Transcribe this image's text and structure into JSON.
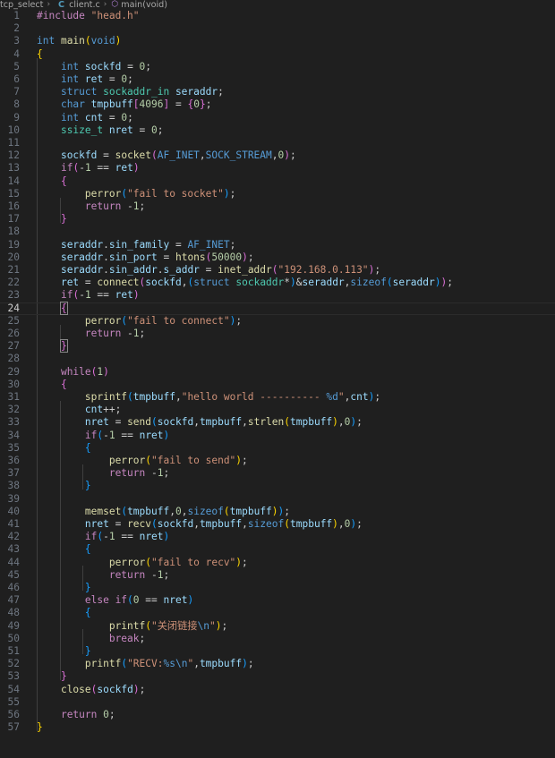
{
  "breadcrumb": {
    "folder": "tcp_select",
    "file_icon": "C",
    "file": "client.c",
    "symbol": "main(void)"
  },
  "editor": {
    "current_line": 24,
    "lines": [
      [
        [
          "t-ctl",
          "#include "
        ],
        [
          "t-str",
          "\"head.h\""
        ]
      ],
      [],
      [
        [
          "t-kw",
          "int "
        ],
        [
          "t-fn",
          "main"
        ],
        [
          "b1",
          "("
        ],
        [
          "t-kw",
          "void"
        ],
        [
          "b1",
          ")"
        ]
      ],
      [
        [
          "b1",
          "{"
        ]
      ],
      [
        [
          "t-p",
          "    "
        ],
        [
          "t-kw",
          "int "
        ],
        [
          "t-var",
          "sockfd"
        ],
        [
          "t-p",
          " = "
        ],
        [
          "t-num",
          "0"
        ],
        [
          "t-p",
          ";"
        ]
      ],
      [
        [
          "t-p",
          "    "
        ],
        [
          "t-kw",
          "int "
        ],
        [
          "t-var",
          "ret"
        ],
        [
          "t-p",
          " = "
        ],
        [
          "t-num",
          "0"
        ],
        [
          "t-p",
          ";"
        ]
      ],
      [
        [
          "t-p",
          "    "
        ],
        [
          "t-kw",
          "struct "
        ],
        [
          "t-ty",
          "sockaddr_in "
        ],
        [
          "t-var",
          "seraddr"
        ],
        [
          "t-p",
          ";"
        ]
      ],
      [
        [
          "t-p",
          "    "
        ],
        [
          "t-kw",
          "char "
        ],
        [
          "t-var",
          "tmpbuff"
        ],
        [
          "b2",
          "["
        ],
        [
          "t-num",
          "4096"
        ],
        [
          "b2",
          "]"
        ],
        [
          "t-p",
          " = "
        ],
        [
          "b2",
          "{"
        ],
        [
          "t-num",
          "0"
        ],
        [
          "b2",
          "}"
        ],
        [
          "t-p",
          ";"
        ]
      ],
      [
        [
          "t-p",
          "    "
        ],
        [
          "t-kw",
          "int "
        ],
        [
          "t-var",
          "cnt"
        ],
        [
          "t-p",
          " = "
        ],
        [
          "t-num",
          "0"
        ],
        [
          "t-p",
          ";"
        ]
      ],
      [
        [
          "t-p",
          "    "
        ],
        [
          "t-ty",
          "ssize_t "
        ],
        [
          "t-var",
          "nret"
        ],
        [
          "t-p",
          " = "
        ],
        [
          "t-num",
          "0"
        ],
        [
          "t-p",
          ";"
        ]
      ],
      [],
      [
        [
          "t-p",
          "    "
        ],
        [
          "t-var",
          "sockfd"
        ],
        [
          "t-p",
          " = "
        ],
        [
          "t-fn",
          "socket"
        ],
        [
          "b2",
          "("
        ],
        [
          "t-mac",
          "AF_INET"
        ],
        [
          "t-p",
          ","
        ],
        [
          "t-mac",
          "SOCK_STREAM"
        ],
        [
          "t-p",
          ","
        ],
        [
          "t-num",
          "0"
        ],
        [
          "b2",
          ")"
        ],
        [
          "t-p",
          ";"
        ]
      ],
      [
        [
          "t-p",
          "    "
        ],
        [
          "t-ctl",
          "if"
        ],
        [
          "b2",
          "("
        ],
        [
          "t-p",
          "-"
        ],
        [
          "t-num",
          "1"
        ],
        [
          "t-p",
          " == "
        ],
        [
          "t-var",
          "ret"
        ],
        [
          "b2",
          ")"
        ]
      ],
      [
        [
          "t-p",
          "    "
        ],
        [
          "b2",
          "{"
        ]
      ],
      [
        [
          "t-p",
          "        "
        ],
        [
          "t-fn",
          "perror"
        ],
        [
          "b3",
          "("
        ],
        [
          "t-str",
          "\"fail to socket\""
        ],
        [
          "b3",
          ")"
        ],
        [
          "t-p",
          ";"
        ]
      ],
      [
        [
          "t-p",
          "        "
        ],
        [
          "t-ctl",
          "return "
        ],
        [
          "t-p",
          "-"
        ],
        [
          "t-num",
          "1"
        ],
        [
          "t-p",
          ";"
        ]
      ],
      [
        [
          "t-p",
          "    "
        ],
        [
          "b2",
          "}"
        ]
      ],
      [],
      [
        [
          "t-p",
          "    "
        ],
        [
          "t-var",
          "seraddr"
        ],
        [
          "t-p",
          "."
        ],
        [
          "t-var",
          "sin_family"
        ],
        [
          "t-p",
          " = "
        ],
        [
          "t-mac",
          "AF_INET"
        ],
        [
          "t-p",
          ";"
        ]
      ],
      [
        [
          "t-p",
          "    "
        ],
        [
          "t-var",
          "seraddr"
        ],
        [
          "t-p",
          "."
        ],
        [
          "t-var",
          "sin_port"
        ],
        [
          "t-p",
          " = "
        ],
        [
          "t-fn",
          "htons"
        ],
        [
          "b2",
          "("
        ],
        [
          "t-num",
          "50000"
        ],
        [
          "b2",
          ")"
        ],
        [
          "t-p",
          ";"
        ]
      ],
      [
        [
          "t-p",
          "    "
        ],
        [
          "t-var",
          "seraddr"
        ],
        [
          "t-p",
          "."
        ],
        [
          "t-var",
          "sin_addr"
        ],
        [
          "t-p",
          "."
        ],
        [
          "t-var",
          "s_addr"
        ],
        [
          "t-p",
          " = "
        ],
        [
          "t-fn",
          "inet_addr"
        ],
        [
          "b2",
          "("
        ],
        [
          "t-str",
          "\"192.168.0.113\""
        ],
        [
          "b2",
          ")"
        ],
        [
          "t-p",
          ";"
        ]
      ],
      [
        [
          "t-p",
          "    "
        ],
        [
          "t-var",
          "ret"
        ],
        [
          "t-p",
          " = "
        ],
        [
          "t-fn",
          "connect"
        ],
        [
          "b2",
          "("
        ],
        [
          "t-var",
          "sockfd"
        ],
        [
          "t-p",
          ","
        ],
        [
          "b3",
          "("
        ],
        [
          "t-kw",
          "struct "
        ],
        [
          "t-ty",
          "sockaddr"
        ],
        [
          "t-p",
          "*"
        ],
        [
          "b3",
          ")"
        ],
        [
          "t-p",
          "&"
        ],
        [
          "t-var",
          "seraddr"
        ],
        [
          "t-p",
          ","
        ],
        [
          "t-kw",
          "sizeof"
        ],
        [
          "b3",
          "("
        ],
        [
          "t-var",
          "seraddr"
        ],
        [
          "b3",
          ")"
        ],
        [
          "b2",
          ")"
        ],
        [
          "t-p",
          ";"
        ]
      ],
      [
        [
          "t-p",
          "    "
        ],
        [
          "t-ctl",
          "if"
        ],
        [
          "b2",
          "("
        ],
        [
          "t-p",
          "-"
        ],
        [
          "t-num",
          "1"
        ],
        [
          "t-p",
          " == "
        ],
        [
          "t-var",
          "ret"
        ],
        [
          "b2",
          ")"
        ]
      ],
      [
        [
          "t-p",
          "    "
        ],
        [
          "b2",
          "{"
        ]
      ],
      [
        [
          "t-p",
          "        "
        ],
        [
          "t-fn",
          "perror"
        ],
        [
          "b3",
          "("
        ],
        [
          "t-str",
          "\"fail to connect\""
        ],
        [
          "b3",
          ")"
        ],
        [
          "t-p",
          ";"
        ]
      ],
      [
        [
          "t-p",
          "        "
        ],
        [
          "t-ctl",
          "return "
        ],
        [
          "t-p",
          "-"
        ],
        [
          "t-num",
          "1"
        ],
        [
          "t-p",
          ";"
        ]
      ],
      [
        [
          "t-p",
          "    "
        ],
        [
          "b2",
          "}"
        ]
      ],
      [],
      [
        [
          "t-p",
          "    "
        ],
        [
          "t-ctl",
          "while"
        ],
        [
          "b2",
          "("
        ],
        [
          "t-num",
          "1"
        ],
        [
          "b2",
          ")"
        ]
      ],
      [
        [
          "t-p",
          "    "
        ],
        [
          "b2",
          "{"
        ]
      ],
      [
        [
          "t-p",
          "        "
        ],
        [
          "t-fn",
          "sprintf"
        ],
        [
          "b3",
          "("
        ],
        [
          "t-var",
          "tmpbuff"
        ],
        [
          "t-p",
          ","
        ],
        [
          "t-str",
          "\"hello world ---------- "
        ],
        [
          "t-kw",
          "%d"
        ],
        [
          "t-str",
          "\""
        ],
        [
          "t-p",
          ","
        ],
        [
          "t-var",
          "cnt"
        ],
        [
          "b3",
          ")"
        ],
        [
          "t-p",
          ";"
        ]
      ],
      [
        [
          "t-p",
          "        "
        ],
        [
          "t-var",
          "cnt"
        ],
        [
          "t-p",
          "++;"
        ]
      ],
      [
        [
          "t-p",
          "        "
        ],
        [
          "t-var",
          "nret"
        ],
        [
          "t-p",
          " = "
        ],
        [
          "t-fn",
          "send"
        ],
        [
          "b3",
          "("
        ],
        [
          "t-var",
          "sockfd"
        ],
        [
          "t-p",
          ","
        ],
        [
          "t-var",
          "tmpbuff"
        ],
        [
          "t-p",
          ","
        ],
        [
          "t-fn",
          "strlen"
        ],
        [
          "b1",
          "("
        ],
        [
          "t-var",
          "tmpbuff"
        ],
        [
          "b1",
          ")"
        ],
        [
          "t-p",
          ","
        ],
        [
          "t-num",
          "0"
        ],
        [
          "b3",
          ")"
        ],
        [
          "t-p",
          ";"
        ]
      ],
      [
        [
          "t-p",
          "        "
        ],
        [
          "t-ctl",
          "if"
        ],
        [
          "b3",
          "("
        ],
        [
          "t-p",
          "-"
        ],
        [
          "t-num",
          "1"
        ],
        [
          "t-p",
          " == "
        ],
        [
          "t-var",
          "nret"
        ],
        [
          "b3",
          ")"
        ]
      ],
      [
        [
          "t-p",
          "        "
        ],
        [
          "b3",
          "{"
        ]
      ],
      [
        [
          "t-p",
          "            "
        ],
        [
          "t-fn",
          "perror"
        ],
        [
          "b1",
          "("
        ],
        [
          "t-str",
          "\"fail to send\""
        ],
        [
          "b1",
          ")"
        ],
        [
          "t-p",
          ";"
        ]
      ],
      [
        [
          "t-p",
          "            "
        ],
        [
          "t-ctl",
          "return "
        ],
        [
          "t-p",
          "-"
        ],
        [
          "t-num",
          "1"
        ],
        [
          "t-p",
          ";"
        ]
      ],
      [
        [
          "t-p",
          "        "
        ],
        [
          "b3",
          "}"
        ]
      ],
      [],
      [
        [
          "t-p",
          "        "
        ],
        [
          "t-fn",
          "memset"
        ],
        [
          "b3",
          "("
        ],
        [
          "t-var",
          "tmpbuff"
        ],
        [
          "t-p",
          ","
        ],
        [
          "t-num",
          "0"
        ],
        [
          "t-p",
          ","
        ],
        [
          "t-kw",
          "sizeof"
        ],
        [
          "b1",
          "("
        ],
        [
          "t-var",
          "tmpbuff"
        ],
        [
          "b1",
          ")"
        ],
        [
          "b3",
          ")"
        ],
        [
          "t-p",
          ";"
        ]
      ],
      [
        [
          "t-p",
          "        "
        ],
        [
          "t-var",
          "nret"
        ],
        [
          "t-p",
          " = "
        ],
        [
          "t-fn",
          "recv"
        ],
        [
          "b3",
          "("
        ],
        [
          "t-var",
          "sockfd"
        ],
        [
          "t-p",
          ","
        ],
        [
          "t-var",
          "tmpbuff"
        ],
        [
          "t-p",
          ","
        ],
        [
          "t-kw",
          "sizeof"
        ],
        [
          "b1",
          "("
        ],
        [
          "t-var",
          "tmpbuff"
        ],
        [
          "b1",
          ")"
        ],
        [
          "t-p",
          ","
        ],
        [
          "t-num",
          "0"
        ],
        [
          "b3",
          ")"
        ],
        [
          "t-p",
          ";"
        ]
      ],
      [
        [
          "t-p",
          "        "
        ],
        [
          "t-ctl",
          "if"
        ],
        [
          "b3",
          "("
        ],
        [
          "t-p",
          "-"
        ],
        [
          "t-num",
          "1"
        ],
        [
          "t-p",
          " == "
        ],
        [
          "t-var",
          "nret"
        ],
        [
          "b3",
          ")"
        ]
      ],
      [
        [
          "t-p",
          "        "
        ],
        [
          "b3",
          "{"
        ]
      ],
      [
        [
          "t-p",
          "            "
        ],
        [
          "t-fn",
          "perror"
        ],
        [
          "b1",
          "("
        ],
        [
          "t-str",
          "\"fail to recv\""
        ],
        [
          "b1",
          ")"
        ],
        [
          "t-p",
          ";"
        ]
      ],
      [
        [
          "t-p",
          "            "
        ],
        [
          "t-ctl",
          "return "
        ],
        [
          "t-p",
          "-"
        ],
        [
          "t-num",
          "1"
        ],
        [
          "t-p",
          ";"
        ]
      ],
      [
        [
          "t-p",
          "        "
        ],
        [
          "b3",
          "}"
        ]
      ],
      [
        [
          "t-p",
          "        "
        ],
        [
          "t-ctl",
          "else if"
        ],
        [
          "b3",
          "("
        ],
        [
          "t-num",
          "0"
        ],
        [
          "t-p",
          " == "
        ],
        [
          "t-var",
          "nret"
        ],
        [
          "b3",
          ")"
        ]
      ],
      [
        [
          "t-p",
          "        "
        ],
        [
          "b3",
          "{"
        ]
      ],
      [
        [
          "t-p",
          "            "
        ],
        [
          "t-fn",
          "printf"
        ],
        [
          "b1",
          "("
        ],
        [
          "t-str",
          "\"关闭链接"
        ],
        [
          "t-kw",
          "\\n"
        ],
        [
          "t-str",
          "\""
        ],
        [
          "b1",
          ")"
        ],
        [
          "t-p",
          ";"
        ]
      ],
      [
        [
          "t-p",
          "            "
        ],
        [
          "t-ctl",
          "break"
        ],
        [
          "t-p",
          ";"
        ]
      ],
      [
        [
          "t-p",
          "        "
        ],
        [
          "b3",
          "}"
        ]
      ],
      [
        [
          "t-p",
          "        "
        ],
        [
          "t-fn",
          "printf"
        ],
        [
          "b3",
          "("
        ],
        [
          "t-str",
          "\"RECV:"
        ],
        [
          "t-kw",
          "%s\\n"
        ],
        [
          "t-str",
          "\""
        ],
        [
          "t-p",
          ","
        ],
        [
          "t-var",
          "tmpbuff"
        ],
        [
          "b3",
          ")"
        ],
        [
          "t-p",
          ";"
        ]
      ],
      [
        [
          "t-p",
          "    "
        ],
        [
          "b2",
          "}"
        ]
      ],
      [
        [
          "t-p",
          "    "
        ],
        [
          "t-fn",
          "close"
        ],
        [
          "b2",
          "("
        ],
        [
          "t-var",
          "sockfd"
        ],
        [
          "b2",
          ")"
        ],
        [
          "t-p",
          ";"
        ]
      ],
      [],
      [
        [
          "t-p",
          "    "
        ],
        [
          "t-ctl",
          "return "
        ],
        [
          "t-num",
          "0"
        ],
        [
          "t-p",
          ";"
        ]
      ],
      [
        [
          "b1",
          "}"
        ]
      ]
    ]
  }
}
